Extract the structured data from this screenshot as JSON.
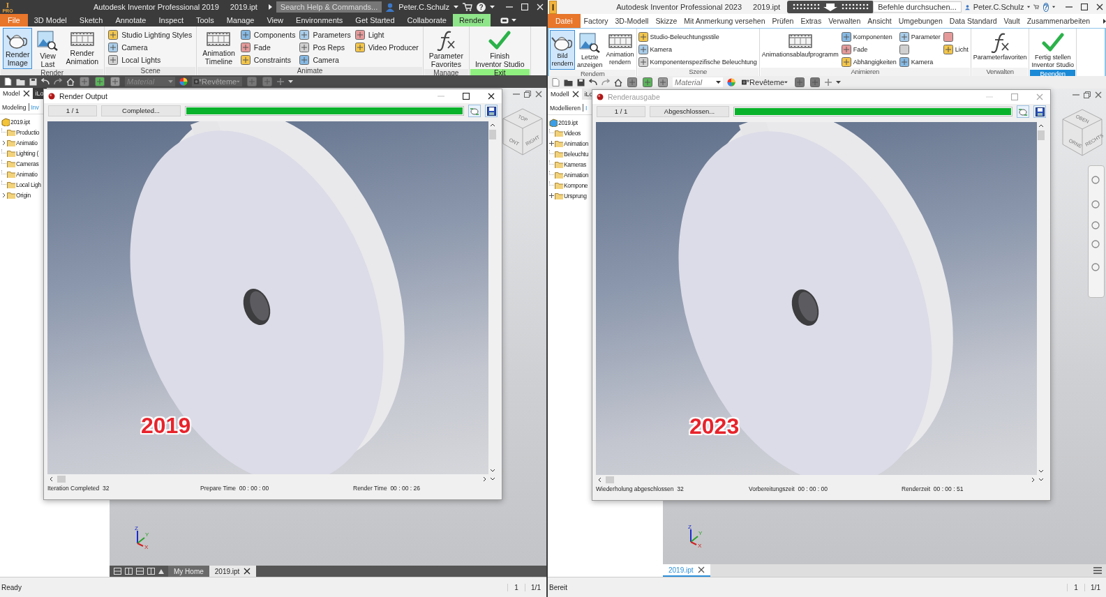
{
  "windows": [
    {
      "kind": "dark",
      "title_bar": {
        "logo_letter": "I",
        "logo_badge": "PRO",
        "app_title": "Autodesk Inventor Professional 2019",
        "file_name": "2019.ipt",
        "search_placeholder": "Search Help & Commands...",
        "user": "Peter.C.Schulz",
        "help": "?"
      },
      "menu_tabs": [
        {
          "label": "File",
          "kind": "file",
          "selected": false
        },
        {
          "label": "3D Model",
          "kind": "tab",
          "selected": false
        },
        {
          "label": "Sketch",
          "kind": "tab",
          "selected": false
        },
        {
          "label": "Annotate",
          "kind": "tab",
          "selected": false
        },
        {
          "label": "Inspect",
          "kind": "tab",
          "selected": false
        },
        {
          "label": "Tools",
          "kind": "tab",
          "selected": false
        },
        {
          "label": "Manage",
          "kind": "tab",
          "selected": false
        },
        {
          "label": "View",
          "kind": "tab",
          "selected": false
        },
        {
          "label": "Environments",
          "kind": "tab",
          "selected": false
        },
        {
          "label": "Get Started",
          "kind": "tab",
          "selected": false
        },
        {
          "label": "Collaborate",
          "kind": "tab",
          "selected": false
        },
        {
          "label": "Render",
          "kind": "tab",
          "selected": true
        }
      ],
      "ribbon": [
        {
          "label": "Render",
          "highlighted": false,
          "items": [
            {
              "kind": "large",
              "label": "Render\nImage",
              "highlighted": true
            },
            {
              "kind": "large",
              "label": "View\nLast",
              "highlighted": false
            },
            {
              "kind": "large",
              "label": "Render\nAnimation",
              "highlighted": false
            }
          ]
        },
        {
          "label": "Scene",
          "highlighted": false,
          "items": [
            {
              "kind": "column",
              "buttons": [
                {
                  "kind": "labeled",
                  "label": "Studio Lighting Styles"
                },
                {
                  "kind": "labeled",
                  "label": "Camera"
                },
                {
                  "kind": "labeled",
                  "label": "Local Lights"
                }
              ]
            }
          ]
        },
        {
          "label": "Animate",
          "highlighted": false,
          "items": [
            {
              "kind": "large",
              "label": "Animation\nTimeline",
              "highlighted": false
            },
            {
              "kind": "column",
              "buttons": [
                {
                  "kind": "labeled",
                  "label": "Components"
                },
                {
                  "kind": "labeled",
                  "label": "Fade"
                },
                {
                  "kind": "labeled",
                  "label": "Constraints"
                }
              ]
            },
            {
              "kind": "column",
              "buttons": [
                {
                  "kind": "labeled",
                  "label": "Parameters"
                },
                {
                  "kind": "labeled",
                  "label": "Pos Reps"
                },
                {
                  "kind": "labeled",
                  "label": "Camera"
                }
              ]
            },
            {
              "kind": "column",
              "buttons": [
                {
                  "kind": "labeled",
                  "label": "Light"
                },
                {
                  "kind": "labeled",
                  "label": "Video Producer"
                }
              ]
            }
          ]
        },
        {
          "label": "Manage",
          "highlighted": false,
          "items": [
            {
              "kind": "large",
              "label": "Parameter\nFavorites",
              "highlighted": false
            }
          ]
        },
        {
          "label": "Exit",
          "highlighted": true,
          "items": [
            {
              "kind": "large",
              "label": "Finish\nInventor Studio",
              "highlighted": false
            }
          ]
        }
      ],
      "quick_access": {
        "material": "Material",
        "appearance": "*Revêteme"
      },
      "browser": {
        "tabs": [
          {
            "label": "Model",
            "selected": true
          },
          {
            "label": "iLo",
            "selected": false
          }
        ],
        "modes": [
          {
            "label": "Modeling",
            "selected": true
          },
          {
            "label": "Inv",
            "selected": false
          }
        ],
        "tree": {
          "label": "2019.ipt",
          "children": [
            {
              "label": "Productio",
              "has_children": false
            },
            {
              "label": "Animatio",
              "has_children": true
            },
            {
              "label": "Lighting (",
              "has_children": false
            },
            {
              "label": "Cameras",
              "has_children": false
            },
            {
              "label": "Animatio",
              "has_children": false
            },
            {
              "label": "Local Ligh",
              "has_children": false
            },
            {
              "label": "Origin",
              "has_children": true
            }
          ]
        }
      },
      "render_dialog": {
        "title": "Render Output",
        "active": true,
        "counter": "1 / 1",
        "status": "Completed...",
        "level": 1,
        "caption": "2019",
        "footer": [
          "Iteration Completed  32",
          "Prepare Time  00 : 00 : 00",
          "Render Time  00 : 00 : 26"
        ]
      },
      "view_cube": [
        "TOP",
        "ONT",
        "RIGHT"
      ],
      "axes": [
        "Z",
        "Y",
        "X"
      ],
      "doc_tabs": [
        {
          "label": "My Home",
          "selected": false
        },
        {
          "label": "2019.ipt",
          "selected": true
        }
      ],
      "status_bar": {
        "text": "Ready",
        "page": "1",
        "pages": "1/1"
      }
    },
    {
      "kind": "light",
      "title_bar": {
        "logo_letter": "I",
        "app_title": "Autodesk Inventor Professional 2023",
        "file_name": "2019.ipt",
        "search_placeholder": "Befehle durchsuchen...",
        "user": "Peter.C.Schulz",
        "help": "?"
      },
      "menu_tabs": [
        {
          "label": "Datei",
          "kind": "file",
          "selected": false
        },
        {
          "label": "Factory",
          "kind": "tab",
          "selected": false
        },
        {
          "label": "3D-Modell",
          "kind": "tab",
          "selected": false
        },
        {
          "label": "Skizze",
          "kind": "tab",
          "selected": false
        },
        {
          "label": "Mit Anmerkung versehen",
          "kind": "tab",
          "selected": false
        },
        {
          "label": "Prüfen",
          "kind": "tab",
          "selected": false
        },
        {
          "label": "Extras",
          "kind": "tab",
          "selected": false
        },
        {
          "label": "Verwalten",
          "kind": "tab",
          "selected": false
        },
        {
          "label": "Ansicht",
          "kind": "tab",
          "selected": false
        },
        {
          "label": "Umgebungen",
          "kind": "tab",
          "selected": false
        },
        {
          "label": "Data Standard",
          "kind": "tab",
          "selected": false
        },
        {
          "label": "Vault",
          "kind": "tab",
          "selected": false
        },
        {
          "label": "Zusammenarbeiten",
          "kind": "tab",
          "selected": false
        }
      ],
      "ribbon": [
        {
          "label": "Rendern",
          "highlighted": false,
          "items": [
            {
              "kind": "large",
              "label": "Bild\nrendern",
              "highlighted": true
            },
            {
              "kind": "large",
              "label": "Letzte\nanzeigen",
              "highlighted": false
            },
            {
              "kind": "large",
              "label": "Animation\nrendern",
              "highlighted": false
            }
          ]
        },
        {
          "label": "Szene",
          "highlighted": false,
          "items": [
            {
              "kind": "column",
              "buttons": [
                {
                  "kind": "labeled",
                  "label": "Studio-Beleuchtungsstile"
                },
                {
                  "kind": "labeled",
                  "label": "Kamera"
                },
                {
                  "kind": "labeled",
                  "label": "Komponentenspezifische Beleuchtung"
                }
              ]
            }
          ]
        },
        {
          "label": "Animieren",
          "highlighted": false,
          "items": [
            {
              "kind": "large",
              "label": "Animationsablaufprogramm",
              "highlighted": false
            },
            {
              "kind": "column",
              "buttons": [
                {
                  "kind": "labeled",
                  "label": "Komponenten"
                },
                {
                  "kind": "labeled",
                  "label": "Fade"
                },
                {
                  "kind": "labeled",
                  "label": "Abhängigkeiten"
                }
              ]
            },
            {
              "kind": "column",
              "buttons": [
                {
                  "kind": "labeled",
                  "label": "Parameter"
                },
                {
                  "kind": "icon"
                },
                {
                  "kind": "labeled",
                  "label": "Kamera"
                }
              ]
            },
            {
              "kind": "column",
              "buttons": [
                {
                  "kind": "icon"
                },
                {
                  "kind": "labeled",
                  "label": "Licht"
                }
              ]
            }
          ]
        },
        {
          "label": "Verwalten",
          "highlighted": false,
          "items": [
            {
              "kind": "large",
              "label": "Parameterfavoriten",
              "highlighted": false
            }
          ]
        },
        {
          "label": "Beenden",
          "highlighted": true,
          "items": [
            {
              "kind": "large",
              "label": "Fertig stellen\nInventor Studio",
              "highlighted": false
            }
          ]
        }
      ],
      "quick_access": {
        "material": "Material",
        "appearance": "*Revêteme"
      },
      "browser": {
        "tabs": [
          {
            "label": "Modell",
            "selected": true
          },
          {
            "label": "iLo",
            "selected": false
          }
        ],
        "modes": [
          {
            "label": "Modellieren",
            "selected": true
          },
          {
            "label": "I",
            "selected": false
          }
        ],
        "tree": {
          "label": "2019.ipt",
          "children": [
            {
              "label": "Videos",
              "has_children": false
            },
            {
              "label": "Animation",
              "has_children": true
            },
            {
              "label": "Beleuchtu",
              "has_children": false
            },
            {
              "label": "Kameras",
              "has_children": false
            },
            {
              "label": "Animation",
              "has_children": false
            },
            {
              "label": "Kompone",
              "has_children": false
            },
            {
              "label": "Ursprung",
              "has_children": true
            }
          ]
        }
      },
      "render_dialog": {
        "title": "Renderausgabe",
        "active": false,
        "counter": "1 / 1",
        "status": "Abgeschlossen...",
        "level": 1,
        "caption": "2023",
        "footer": [
          "Wiederholung abgeschlossen  32",
          "Vorbereitungszeit  00 : 00 : 00",
          "Renderzeit  00 : 00 : 51"
        ]
      },
      "view_cube": [
        "OBEN",
        "ORNE",
        "RECHTS"
      ],
      "axes": [
        "Z",
        "Y",
        "X"
      ],
      "doc_tabs": [
        {
          "label": "2019.ipt",
          "selected": true
        }
      ],
      "status_bar": {
        "text": "Bereit",
        "page": "1",
        "pages": "1/1"
      }
    }
  ]
}
